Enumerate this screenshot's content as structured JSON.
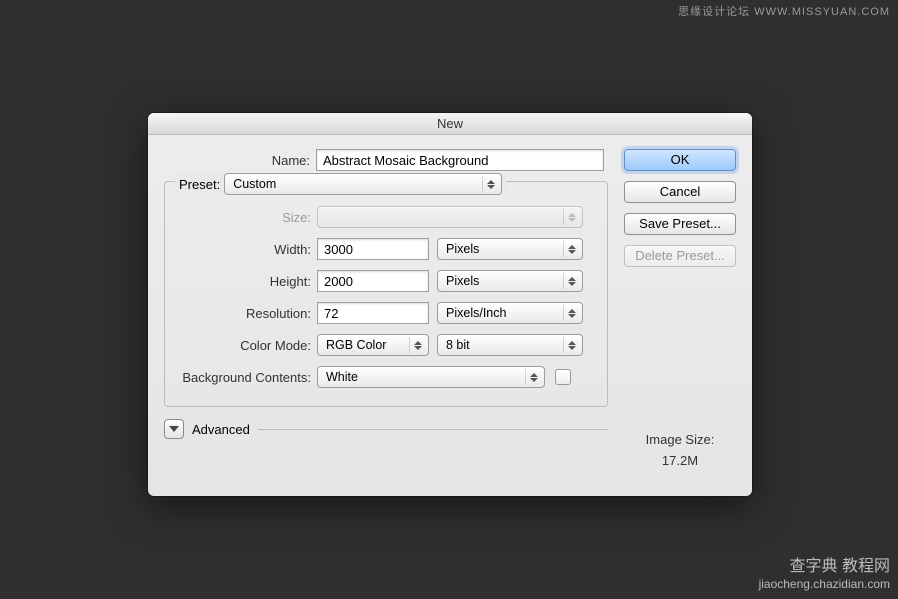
{
  "watermark_top": "思缘设计论坛 WWW.MISSYUAN.COM",
  "watermark_bottom_big": "查字典 教程网",
  "watermark_bottom_small": "jiaocheng.chazidian.com",
  "window": {
    "title": "New"
  },
  "labels": {
    "name": "Name:",
    "preset": "Preset:",
    "size": "Size:",
    "width": "Width:",
    "height": "Height:",
    "resolution": "Resolution:",
    "color_mode": "Color Mode:",
    "bg_contents": "Background Contents:",
    "advanced": "Advanced",
    "image_size": "Image Size:"
  },
  "values": {
    "name": "Abstract Mosaic Background",
    "preset": "Custom",
    "width": "3000",
    "width_unit": "Pixels",
    "height": "2000",
    "height_unit": "Pixels",
    "resolution": "72",
    "resolution_unit": "Pixels/Inch",
    "color_mode": "RGB Color",
    "bit_depth": "8 bit",
    "bg_contents": "White",
    "image_size": "17.2M"
  },
  "buttons": {
    "ok": "OK",
    "cancel": "Cancel",
    "save_preset": "Save Preset...",
    "delete_preset": "Delete Preset..."
  }
}
